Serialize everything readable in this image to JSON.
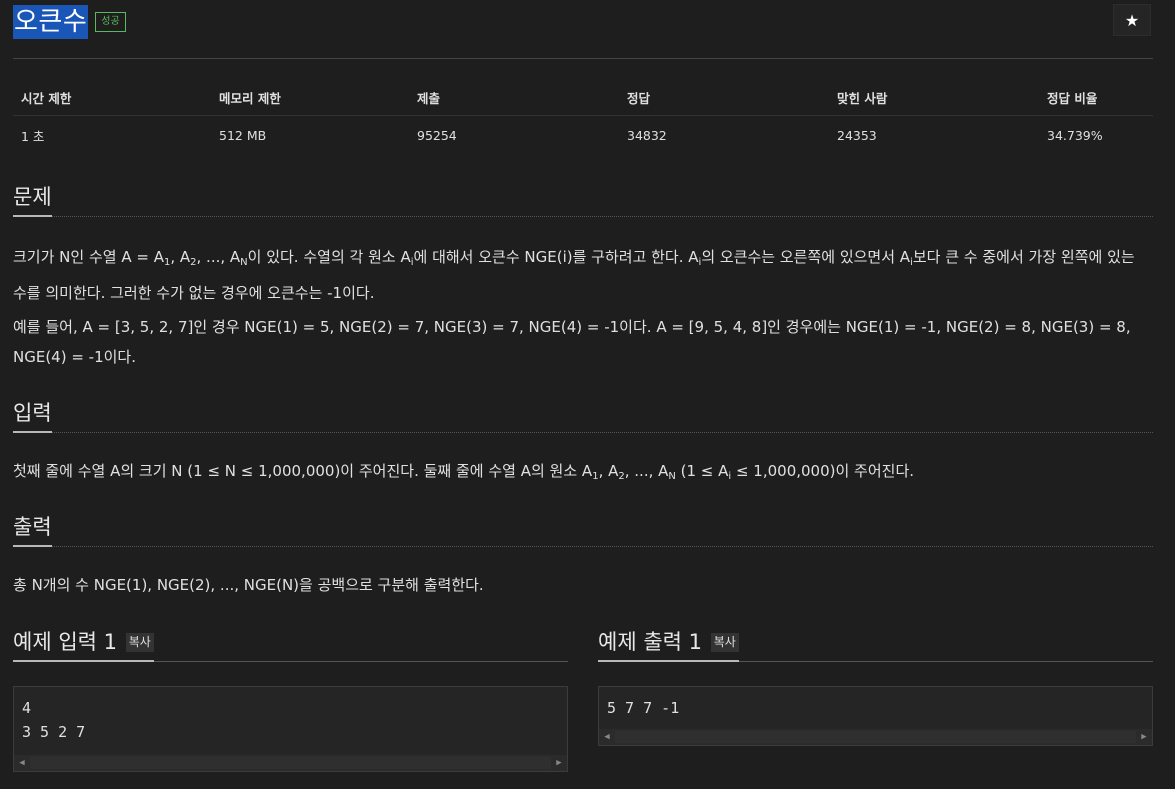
{
  "problem": {
    "title": "오큰수",
    "status_badge": "성공"
  },
  "star_icon": "★",
  "stats": {
    "headers": [
      "시간 제한",
      "메모리 제한",
      "제출",
      "정답",
      "맞힌 사람",
      "정답 비율"
    ],
    "values": [
      "1 초",
      "512 MB",
      "95254",
      "34832",
      "24353",
      "34.739%"
    ]
  },
  "sections": {
    "description": {
      "heading": "문제",
      "p1": {
        "t1": "크기가 N인 수열 A = A",
        "s1": "1",
        "t2": ", A",
        "s2": "2",
        "t3": ", ..., A",
        "s3": "N",
        "t4": "이 있다. 수열의 각 원소 A",
        "s4": "i",
        "t5": "에 대해서 오큰수 NGE(i)를 구하려고 한다. A",
        "s5": "i",
        "t6": "의 오큰수는 오른쪽에 있으면서 A",
        "s6": "i",
        "t7": "보다 큰 수 중에서 가장 왼쪽에 있는 수를 의미한다. 그러한 수가 없는 경우에 오큰수는 -1이다."
      },
      "p2": "예를 들어, A = [3, 5, 2, 7]인 경우 NGE(1) = 5, NGE(2) = 7, NGE(3) = 7, NGE(4) = -1이다. A = [9, 5, 4, 8]인 경우에는 NGE(1) = -1, NGE(2) = 8, NGE(3) = 8, NGE(4) = -1이다."
    },
    "input": {
      "heading": "입력",
      "t1": "첫째 줄에 수열 A의 크기 N (1 ≤ N ≤ 1,000,000)이 주어진다. 둘째 줄에 수열 A의 원소 A",
      "s1": "1",
      "t2": ", A",
      "s2": "2",
      "t3": ", ..., A",
      "s3": "N",
      "t4": " (1 ≤ A",
      "s4": "i",
      "t5": " ≤ 1,000,000)이 주어진다."
    },
    "output": {
      "heading": "출력",
      "text": "총 N개의 수 NGE(1), NGE(2), ..., NGE(N)을 공백으로 구분해 출력한다."
    }
  },
  "samples": {
    "input": {
      "heading": "예제 입력 1",
      "copy_label": "복사",
      "lines": [
        "4",
        "3 5 2 7"
      ]
    },
    "output": {
      "heading": "예제 출력 1",
      "copy_label": "복사",
      "lines": [
        "5 7 7 -1"
      ]
    }
  },
  "scroll": {
    "left_arrow": "◀",
    "right_arrow": "▶"
  }
}
